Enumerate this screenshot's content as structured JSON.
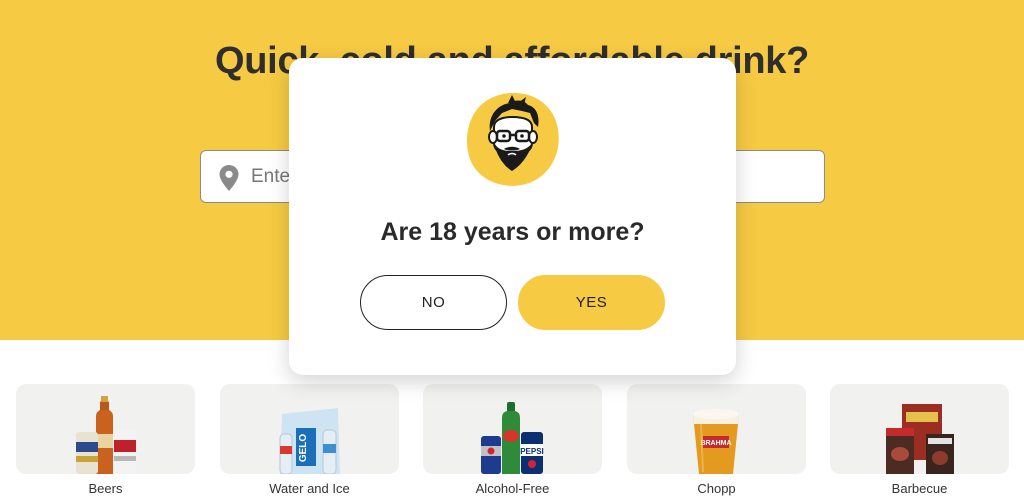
{
  "hero": {
    "title": "Quick, cold and affordable drink?",
    "background_color": "#f7ca43"
  },
  "address": {
    "placeholder": "Enter your address",
    "icon": "map-pin-icon"
  },
  "categories": [
    {
      "label": "Beers",
      "icon": "beers-icon"
    },
    {
      "label": "Water and Ice",
      "icon": "water-ice-icon"
    },
    {
      "label": "Alcohol-Free",
      "icon": "alcohol-free-icon"
    },
    {
      "label": "Chopp",
      "icon": "chopp-icon"
    },
    {
      "label": "Barbecue",
      "icon": "barbecue-icon"
    }
  ],
  "age_modal": {
    "question": "Are 18 years or more?",
    "no_label": "NO",
    "yes_label": "YES",
    "avatar": "bearded-man-avatar",
    "accent_color": "#f7ca43"
  }
}
